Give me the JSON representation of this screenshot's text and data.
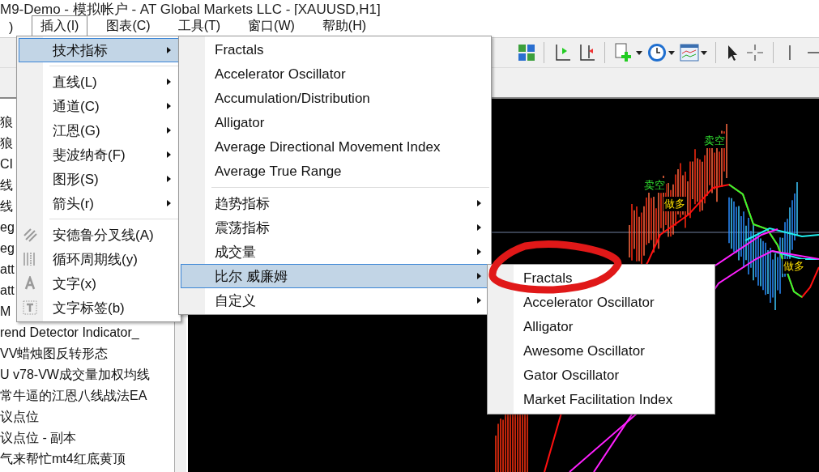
{
  "window": {
    "title": "M9-Demo - 模拟帐户 - AT Global Markets LLC - [XAUUSD,H1]"
  },
  "menubar": [
    {
      "label": ")",
      "selected": false
    },
    {
      "label": "插入(I)",
      "selected": true
    },
    {
      "label": "图表(C)",
      "selected": false
    },
    {
      "label": "工具(T)",
      "selected": false
    },
    {
      "label": "窗口(W)",
      "selected": false
    },
    {
      "label": "帮助(H)",
      "selected": false
    }
  ],
  "navigator": {
    "items": [
      "狼",
      "狼",
      "CI",
      "线",
      "线",
      "eg",
      "eg",
      "att",
      "att",
      "M",
      "rend Detector Indicator_",
      "VV蜡烛图反转形态",
      "U v78-VW成交量加权均线",
      "常牛逼的江恩八线战法EA",
      "议点位",
      "议点位 - 副本",
      "气来帮忙mt4红底黄顶"
    ]
  },
  "insert_menu": [
    {
      "kind": "submenu",
      "label": "技术指标",
      "selected": true
    },
    {
      "kind": "separator"
    },
    {
      "kind": "submenu",
      "label": "直线(L)",
      "selected": false
    },
    {
      "kind": "submenu",
      "label": "通道(C)",
      "selected": false
    },
    {
      "kind": "submenu",
      "label": "江恩(G)",
      "selected": false
    },
    {
      "kind": "submenu",
      "label": "斐波纳奇(F)",
      "selected": false
    },
    {
      "kind": "submenu",
      "label": "图形(S)",
      "selected": false
    },
    {
      "kind": "submenu",
      "label": "箭头(r)",
      "selected": false
    },
    {
      "kind": "separator"
    },
    {
      "kind": "command",
      "label": "安德鲁分叉线(A)",
      "selected": false
    },
    {
      "kind": "command",
      "label": "循环周期线(y)",
      "selected": false
    },
    {
      "kind": "command",
      "label": "文字(x)",
      "selected": false
    },
    {
      "kind": "command",
      "label": "文字标签(b)",
      "selected": false
    }
  ],
  "indicators_menu": [
    {
      "kind": "command",
      "label": "Fractals",
      "selected": false
    },
    {
      "kind": "command",
      "label": "Accelerator Oscillator",
      "selected": false
    },
    {
      "kind": "command",
      "label": "Accumulation/Distribution",
      "selected": false
    },
    {
      "kind": "command",
      "label": "Alligator",
      "selected": false
    },
    {
      "kind": "command",
      "label": "Average Directional Movement Index",
      "selected": false
    },
    {
      "kind": "command",
      "label": "Average True Range",
      "selected": false
    },
    {
      "kind": "separator"
    },
    {
      "kind": "submenu",
      "label": "趋势指标",
      "selected": false
    },
    {
      "kind": "submenu",
      "label": "震荡指标",
      "selected": false
    },
    {
      "kind": "submenu",
      "label": "成交量",
      "selected": false
    },
    {
      "kind": "submenu",
      "label": "比尔 威廉姆",
      "selected": true
    },
    {
      "kind": "submenu",
      "label": "自定义",
      "selected": false
    }
  ],
  "bill_williams_menu": [
    {
      "kind": "command",
      "label": "Fractals",
      "selected": false
    },
    {
      "kind": "command",
      "label": "Accelerator Oscillator",
      "selected": false
    },
    {
      "kind": "command",
      "label": "Alligator",
      "selected": false
    },
    {
      "kind": "command",
      "label": "Awesome Oscillator",
      "selected": false
    },
    {
      "kind": "command",
      "label": "Gator Oscillator",
      "selected": false
    },
    {
      "kind": "command",
      "label": "Market Facilitation Index",
      "selected": false
    }
  ],
  "chart_labels": [
    {
      "kind": "sell",
      "label": "卖空"
    },
    {
      "kind": "sell",
      "label": "卖空"
    },
    {
      "kind": "buy",
      "label": "做多"
    },
    {
      "kind": "buy",
      "label": "做多"
    }
  ]
}
